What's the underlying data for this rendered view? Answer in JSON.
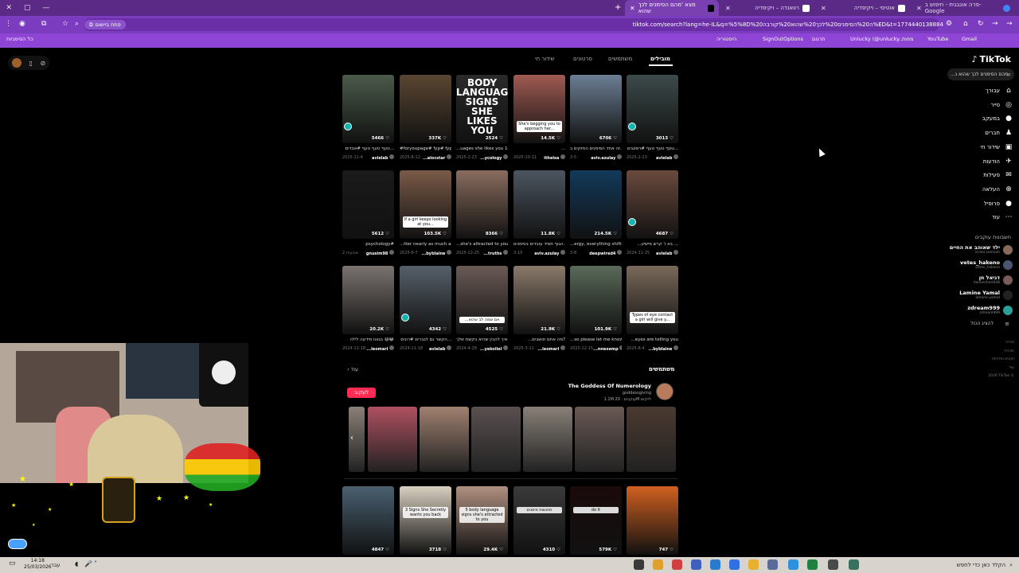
{
  "browser": {
    "window_controls": [
      "✕",
      "▢",
      "—"
    ],
    "new_tab": "+",
    "tabs": [
      {
        "title": "מצא 'מהם הסימנים לכך שהוא",
        "active": true
      },
      {
        "title": "רוואנדה – ויקיפדיה",
        "active": false
      },
      {
        "title": "אוטיסי – ויקיפדיה",
        "active": false
      },
      {
        "title": "פרה אונבגית - חיפוש ב-Google",
        "active": false
      }
    ],
    "url": "tiktok.com/search?lang=he-IL&q=%5%8D%20ה%20הסימנים%20לכך%20שהוא%20קורבה%ED&t=1774440138884",
    "install_chip": "פתח ביישום",
    "bookmarks": [
      "Gmail",
      "YouTube",
      "Unlucky (@unlucky...",
      "תרגום",
      "מפות",
      "SignOutOptions",
      "היסטוריה",
      "כל הסימניות"
    ]
  },
  "tiktok": {
    "logo": "TikTok",
    "search": "מהם הסימנים לכך שהוא נ...",
    "nav": [
      {
        "label": "עבורך",
        "icon": "⌂"
      },
      {
        "label": "סייר",
        "icon": "◎"
      },
      {
        "label": "במעקב",
        "icon": "●"
      },
      {
        "label": "חברים",
        "icon": "♟"
      },
      {
        "label": "שידור חי",
        "icon": "▣"
      },
      {
        "label": "הודעות",
        "icon": "✈"
      },
      {
        "label": "פעילות",
        "icon": "✉"
      },
      {
        "label": "העלאה",
        "icon": "⊕"
      },
      {
        "label": "פרופיל",
        "icon": "●"
      },
      {
        "label": "עוד",
        "icon": "⋯"
      }
    ],
    "following_header": "חשבונות עוקבים",
    "following": [
      {
        "name": "ילד שאוהב את החיים",
        "handle": "israel.zamosh",
        "color": "#8a6b5a"
      },
      {
        "name": "vetes_hakeno",
        "handle": "vetes_hakeno",
        "color": "#4a5670"
      },
      {
        "name": "דניאל חן",
        "handle": "danielchen648",
        "color": "#7a5a5a"
      },
      {
        "name": "Lamine Yamal",
        "handle": "lamine.yamal",
        "color": "#222"
      },
      {
        "name": "zdream999",
        "handle": "zdream999",
        "color": "#2aa198"
      }
    ],
    "show_less": "להציג הכול",
    "footer": [
      "חברה",
      "תוכנית",
      "תנאים ומדיניות",
      "עוד",
      "2026 TikTok ©"
    ],
    "top_tabs": [
      {
        "label": "מובילים",
        "active": true
      },
      {
        "label": "משתמשים",
        "active": false
      },
      {
        "label": "סרטונים",
        "active": false
      },
      {
        "label": "שידור חי",
        "active": false
      }
    ],
    "videos": [
      {
        "bg": "#3d4a4a",
        "count": "3013",
        "label": "",
        "big": "",
        "pin": true,
        "caption": "טעף טעף טעף #רפונגים...",
        "user": "avielab",
        "date": "2025-2-23"
      },
      {
        "bg": "#6c7f94",
        "count": "6706",
        "label": "",
        "big": "",
        "pin": false,
        "caption": "זה אחד הסימנים החזקים ב...",
        "user": "aviv.azulay",
        "date": "3-5"
      },
      {
        "bg": "#a05a52",
        "count": "14.5K",
        "label": "She's begging you to approach her...",
        "big": "",
        "pin": false,
        "caption": "...",
        "user": "ithelsa",
        "date": "2025-10-11"
      },
      {
        "bg": "#2a2a2a",
        "count": "2524",
        "label": "",
        "big": "BODY LANGUAGE SIGNS SHE LIKES YOU",
        "pin": false,
        "caption": "...uages she likes you 10",
        "user": "...ycology",
        "date": "2025-2-23"
      },
      {
        "bg": "#5a4632",
        "count": "337K",
        "label": "",
        "big": "",
        "pin": false,
        "caption": "#foryoupage# fyp# fyp#",
        "user": "...alocstar",
        "date": "2025-8-12"
      },
      {
        "bg": "#4a5a4a",
        "count": "5466",
        "label": "",
        "big": "",
        "pin": true,
        "caption": "טעף טעף טעף #אבדים...",
        "user": "avielab",
        "date": "2025-11-4"
      },
      {
        "bg": "#6a4a3e",
        "count": "4687",
        "label": "",
        "big": "",
        "pin": true,
        "caption": "...בא ו' קרש מישיע ...",
        "user": "avielab",
        "date": "2024-11-25"
      },
      {
        "bg": "#123a5a",
        "count": "214.5K",
        "label": "",
        "big": "",
        "pin": false,
        "caption": "...ergy, everything shifts",
        "user": "deepwired4",
        "date": "3-8"
      },
      {
        "bg": "#4c5560",
        "count": "11.8K",
        "label": "",
        "big": "",
        "pin": false,
        "caption": "הגוף תמיד עובדים בסימנים...",
        "user": "aviv.azulay",
        "date": "3-10"
      },
      {
        "bg": "#8a6c5e",
        "count": "8366",
        "label": "",
        "big": "",
        "pin": false,
        "caption": "...she's attracted to you",
        "user": "...truths",
        "date": "2025-12-25"
      },
      {
        "bg": "#7a5a48",
        "count": "103.5K",
        "label": "If a girl keeps looking at you...",
        "big": "",
        "pin": false,
        "caption": "...tter nearly as much as",
        "user": "...byblaine",
        "date": "2025-6-7"
      },
      {
        "bg": "#1a1a1a",
        "count": "5612",
        "label": "",
        "big": "",
        "pin": false,
        "caption": "psychology#",
        "user": "gnusim98",
        "date": "2 שבועות"
      },
      {
        "bg": "#7a6a5a",
        "count": "",
        "label": "Types of eye contact a girl will give y...",
        "big": "",
        "pin": false,
        "caption": "...eyes are telling you",
        "user": "...byblaine",
        "date": "2025-8-4"
      },
      {
        "bg": "#5a6a5a",
        "count": "101.9K",
        "label": "",
        "big": "",
        "pin": false,
        "caption": "...so please let me know",
        "user": "...nnexemp",
        "date": "2025-12-15"
      },
      {
        "bg": "#8a7a6a",
        "count": "21.9K",
        "label": "",
        "big": "",
        "pin": false,
        "caption": "...מה אתם חושבים?",
        "user": "...leomari",
        "date": "2025-3-11"
      },
      {
        "bg": "#6a5a55",
        "count": "4525",
        "label": "...אם שמה לב שהוא",
        "big": "",
        "pin": false,
        "caption": "איך להבין שהיא בקשת שלך...",
        "user": "...yekoliel",
        "date": "2024-4-28"
      },
      {
        "bg": "#56606a",
        "count": "4342",
        "label": "",
        "big": "",
        "pin": true,
        "caption": "הקשר גם לגברים #רונים...",
        "user": "avielab",
        "date": "2024-11-18"
      },
      {
        "bg": "#7a7370",
        "count": "20.2K",
        "label": "",
        "big": "",
        "pin": false,
        "caption": "בגוונו מידעה לילה 😄😂",
        "user": "...leomari",
        "date": "2024-12-18"
      }
    ],
    "users_header": "משתמשים",
    "more": "עוד",
    "account": {
      "name": "The Goddess Of Numerology",
      "handle": "goddessgiving",
      "stats": "1.1M עוקבים · 20M לייקים",
      "follow": "לעקוב"
    },
    "strip_colors": [
      "#4a3a30",
      "#6a5a55",
      "#888078",
      "#5a5050",
      "#a08070",
      "#b05060",
      "#8a8078",
      "#6a7080"
    ],
    "bottom_videos": [
      {
        "bg": "#4a6070",
        "count": "4847",
        "label": ""
      },
      {
        "bg": "#d8cfc0",
        "count": "3718",
        "label": "3 Signs She Secretly wants you back"
      },
      {
        "bg": "#b09080",
        "count": "29.4K",
        "label": "5 body language signs she's attracted to you"
      },
      {
        "bg": "#3a3a3a",
        "count": "4310",
        "label": "תחושות סימנים"
      },
      {
        "bg": "#1a0a0a",
        "count": "579K",
        "label": "do it"
      },
      {
        "bg": "#d06020",
        "count": "747",
        "label": ""
      }
    ]
  },
  "taskbar": {
    "search_placeholder": "הקלד כאן כדי לחפש",
    "time": "14:18",
    "date": "25/03/2026",
    "lang": "עבר"
  }
}
